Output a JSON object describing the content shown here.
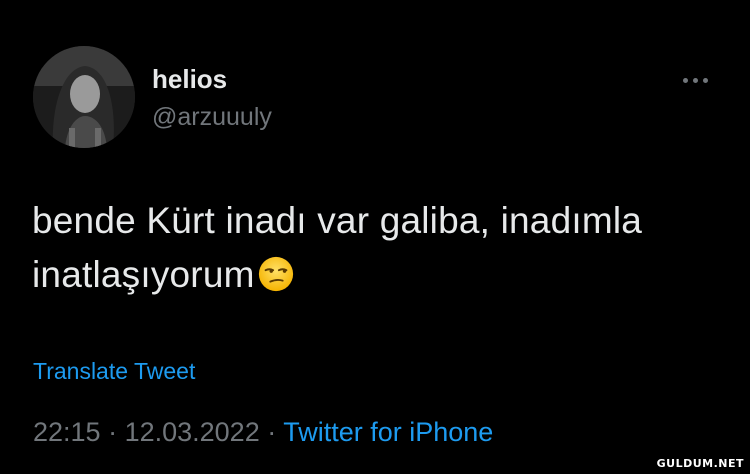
{
  "tweet": {
    "display_name": "helios",
    "handle": "@arzuuuly",
    "text": "bende Kürt inadı var galiba, inadımla inatlaşıyorum",
    "emoji_icon": "unamused-face-icon",
    "translate_label": "Translate Tweet",
    "time": "22:15",
    "separator_1": " · ",
    "date": "12.03.2022",
    "separator_2": " · ",
    "source": "Twitter for iPhone",
    "more_icon": "more-options-icon"
  },
  "watermark": "GULDUM.NET",
  "colors": {
    "background": "#000000",
    "primary_text": "#e7e9ea",
    "secondary_text": "#71767b",
    "accent": "#1d9bf0"
  }
}
